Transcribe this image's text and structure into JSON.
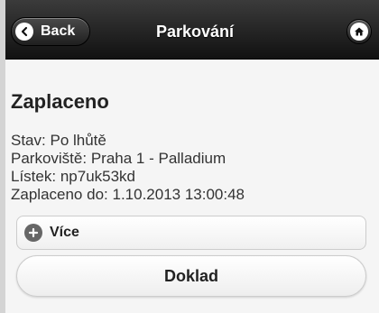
{
  "header": {
    "back_label": "Back",
    "title": "Parkování",
    "home_icon": "home-icon"
  },
  "content": {
    "heading": "Zaplaceno",
    "details": [
      {
        "label": "Stav:",
        "value": "Po lhůtě"
      },
      {
        "label": "Parkoviště:",
        "value": "Praha 1 - Palladium"
      },
      {
        "label": "Lístek:",
        "value": "np7uk53kd"
      },
      {
        "label": "Zaplaceno do:",
        "value": "1.10.2013 13:00:48"
      }
    ],
    "more_label": "Více",
    "receipt_label": "Doklad"
  },
  "colors": {
    "header_background": "#111111",
    "content_background": "#f5f5f5",
    "button_border": "#cccccc",
    "text_primary": "#222222"
  }
}
